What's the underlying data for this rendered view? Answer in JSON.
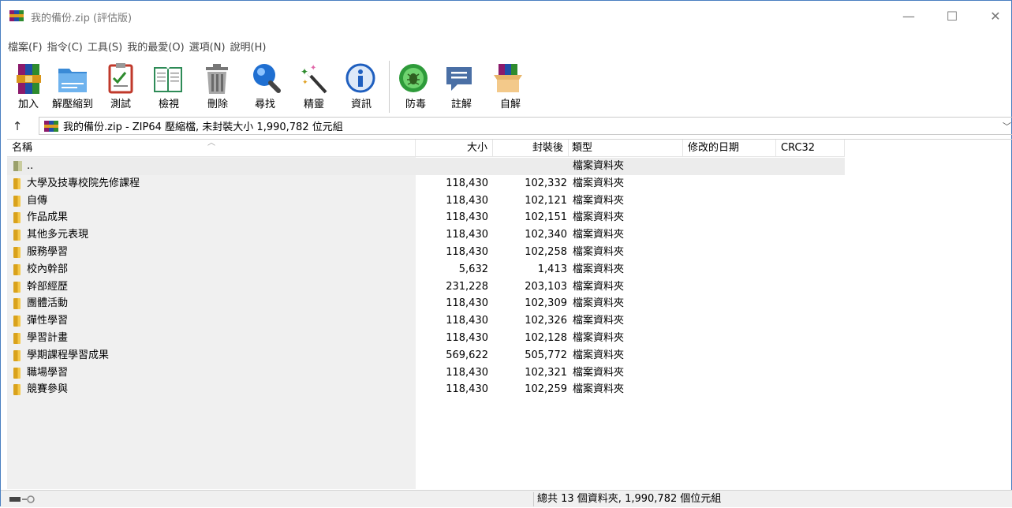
{
  "window": {
    "title": "我的備份.zip (評估版)",
    "minimize": "—",
    "maximize": "☐",
    "close": "✕"
  },
  "menu": [
    "檔案(F)",
    "指令(C)",
    "工具(S)",
    "我的最愛(O)",
    "選項(N)",
    "說明(H)"
  ],
  "toolbar": {
    "group1": [
      {
        "label": "加入",
        "icon": "add-archive-icon"
      },
      {
        "label": "解壓縮到",
        "icon": "extract-to-icon"
      },
      {
        "label": "測試",
        "icon": "test-icon"
      },
      {
        "label": "檢視",
        "icon": "view-icon"
      },
      {
        "label": "刪除",
        "icon": "delete-icon"
      },
      {
        "label": "尋找",
        "icon": "find-icon"
      },
      {
        "label": "精靈",
        "icon": "wizard-icon"
      },
      {
        "label": "資訊",
        "icon": "info-icon"
      }
    ],
    "group2": [
      {
        "label": "防毒",
        "icon": "virus-scan-icon"
      },
      {
        "label": "註解",
        "icon": "comment-icon"
      },
      {
        "label": "自解",
        "icon": "sfx-icon"
      }
    ]
  },
  "address": {
    "up": "↑",
    "path": "我的備份.zip - ZIP64 壓縮檔, 未封裝大小 1,990,782 位元組",
    "chevron": "﹀"
  },
  "columns": {
    "name": "名稱",
    "size": "大小",
    "packed": "封裝後",
    "type": "類型",
    "modified": "修改的日期",
    "crc": "CRC32"
  },
  "parent_row": {
    "name": "..",
    "type": "檔案資料夾"
  },
  "rows": [
    {
      "name": "大學及技專校院先修課程",
      "size": "118,430",
      "packed": "102,332",
      "type": "檔案資料夾"
    },
    {
      "name": "自傳",
      "size": "118,430",
      "packed": "102,121",
      "type": "檔案資料夾"
    },
    {
      "name": "作品成果",
      "size": "118,430",
      "packed": "102,151",
      "type": "檔案資料夾"
    },
    {
      "name": "其他多元表現",
      "size": "118,430",
      "packed": "102,340",
      "type": "檔案資料夾"
    },
    {
      "name": "服務學習",
      "size": "118,430",
      "packed": "102,258",
      "type": "檔案資料夾"
    },
    {
      "name": "校內幹部",
      "size": "5,632",
      "packed": "1,413",
      "type": "檔案資料夾"
    },
    {
      "name": "幹部經歷",
      "size": "231,228",
      "packed": "203,103",
      "type": "檔案資料夾"
    },
    {
      "name": "團體活動",
      "size": "118,430",
      "packed": "102,309",
      "type": "檔案資料夾"
    },
    {
      "name": "彈性學習",
      "size": "118,430",
      "packed": "102,326",
      "type": "檔案資料夾"
    },
    {
      "name": "學習計畫",
      "size": "118,430",
      "packed": "102,128",
      "type": "檔案資料夾"
    },
    {
      "name": "學期課程學習成果",
      "size": "569,622",
      "packed": "505,772",
      "type": "檔案資料夾"
    },
    {
      "name": "職場學習",
      "size": "118,430",
      "packed": "102,321",
      "type": "檔案資料夾"
    },
    {
      "name": "競賽參與",
      "size": "118,430",
      "packed": "102,259",
      "type": "檔案資料夾"
    }
  ],
  "status": {
    "text": "總共 13 個資料夾, 1,990,782 個位元組"
  }
}
